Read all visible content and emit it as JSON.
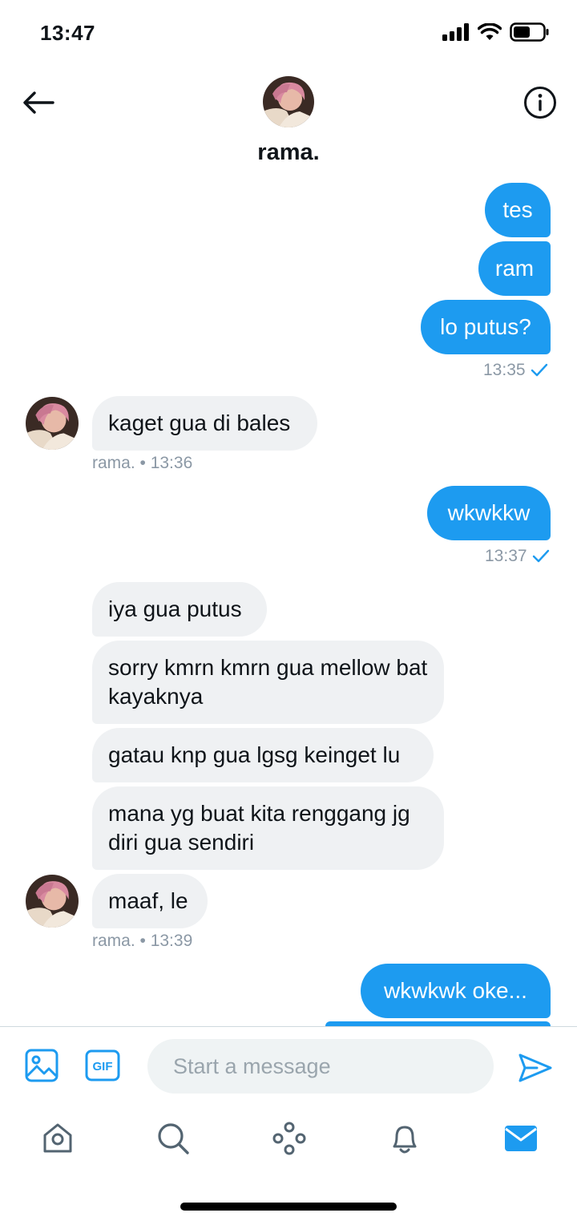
{
  "status_bar": {
    "time": "13:47"
  },
  "header": {
    "contact_name": "rama."
  },
  "messages": [
    {
      "sender": "me",
      "text": "tes"
    },
    {
      "sender": "me",
      "text": "ram"
    },
    {
      "sender": "me",
      "text": "lo putus?"
    },
    {
      "sender": "rama",
      "text": "kaget gua di bales"
    },
    {
      "sender": "me",
      "text": "wkwkkw"
    },
    {
      "sender": "rama",
      "text": "iya gua putus"
    },
    {
      "sender": "rama",
      "text": "sorry kmrn kmrn gua mellow bat kayaknya"
    },
    {
      "sender": "rama",
      "text": "gatau knp gua lgsg keinget lu"
    },
    {
      "sender": "rama",
      "text": "mana yg buat kita renggang jg diri gua sendiri"
    },
    {
      "sender": "rama",
      "text": "maaf, le"
    },
    {
      "sender": "me",
      "text": "wkwkwk oke..."
    }
  ],
  "meta": {
    "m1": {
      "time": "13:35"
    },
    "m2": {
      "text": "rama. • 13:36"
    },
    "m3": {
      "time": "13:37"
    },
    "m4": {
      "text": "rama. • 13:39"
    }
  },
  "composer": {
    "placeholder": "Start a message",
    "gif_label": "GIF"
  },
  "tabs": [
    "home",
    "search",
    "spaces",
    "notifications",
    "messages"
  ],
  "colors": {
    "accent": "#1d9bf0",
    "received_bubble": "#eff1f3",
    "meta_text": "#8b98a5"
  },
  "icons": [
    "back-arrow-icon",
    "info-icon",
    "image-icon",
    "gif-icon",
    "send-icon",
    "home-icon",
    "search-icon",
    "spaces-icon",
    "bell-icon",
    "mail-icon",
    "checkmark-icon",
    "signal-icon",
    "wifi-icon",
    "battery-icon"
  ]
}
